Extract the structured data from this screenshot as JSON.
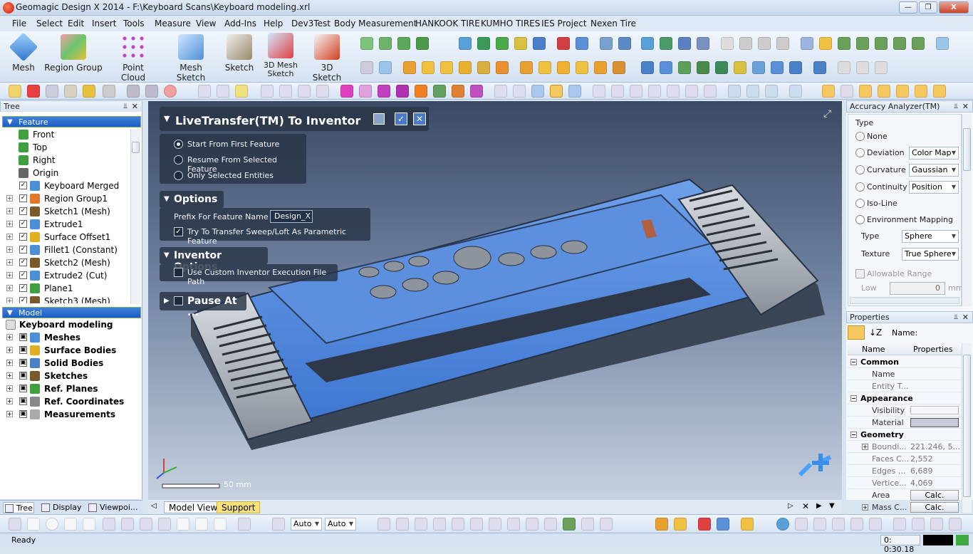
{
  "window": {
    "title": "Geomagic Design X 2014 - F:\\Keyboard Scans\\Keyboard modeling.xrl",
    "min": "—",
    "max": "❐",
    "close": "X"
  },
  "menu": [
    "File",
    "Select",
    "Edit",
    "Insert",
    "Tools",
    "Measure",
    "View",
    "Add-Ins",
    "Help",
    "Dev3Test",
    "Body Measurement",
    "HANKOOK TIRE",
    "KUMHO TIRES",
    "IES Project",
    "Nexen Tire"
  ],
  "ribbon": {
    "buttons": [
      "Mesh",
      "Region Group",
      "Point Cloud",
      "Mesh Sketch",
      "Sketch",
      "3D Mesh Sketch",
      "3D Sketch"
    ]
  },
  "tree": {
    "header": "Tree",
    "feature_section": "Feature",
    "features": [
      {
        "label": "Front",
        "color": "#3fa03f"
      },
      {
        "label": "Top",
        "color": "#3fa03f"
      },
      {
        "label": "Right",
        "color": "#3fa03f"
      },
      {
        "label": "Origin",
        "color": "#444444"
      },
      {
        "label": "Keyboard Merged",
        "color": "#4a90d9"
      },
      {
        "label": "Region Group1",
        "color": "#e07a2a"
      },
      {
        "label": "Sketch1 (Mesh)",
        "color": "#7a5a2a"
      },
      {
        "label": "Extrude1",
        "color": "#4a90d9"
      },
      {
        "label": "Surface Offset1",
        "color": "#e0b020"
      },
      {
        "label": "Fillet1 (Constant)",
        "color": "#4a90d9"
      },
      {
        "label": "Sketch2 (Mesh)",
        "color": "#7a5a2a"
      },
      {
        "label": "Extrude2 (Cut)",
        "color": "#4a90d9"
      },
      {
        "label": "Plane1",
        "color": "#3fa03f"
      },
      {
        "label": "Sketch3 (Mesh)",
        "color": "#7a5a2a"
      }
    ],
    "model_section": "Model",
    "model_root": "Keyboard modeling",
    "model_items": [
      "Meshes",
      "Surface Bodies",
      "Solid Bodies",
      "Sketches",
      "Ref. Planes",
      "Ref. Coordinates",
      "Measurements"
    ],
    "tabs": [
      "Tree",
      "Display",
      "Viewpoi..."
    ]
  },
  "dialog": {
    "title": "LiveTransfer(TM) To Inventor",
    "start_options": [
      "Start From First Feature",
      "Resume From Selected Feature",
      "Only Selected Entities"
    ],
    "selected_start": 0,
    "options_header": "Options",
    "prefix_label": "Prefix For Feature Name",
    "prefix_value": "Design_X",
    "sweep_label": "Try To Transfer Sweep/Loft As Parametric Feature",
    "sweep_checked": true,
    "inventor_header": "Inventor Options",
    "custom_path_label": "Use Custom Inventor Execution File Path",
    "custom_path_checked": false,
    "pause_label": "Pause At ...",
    "pause_checked": false
  },
  "viewport": {
    "scale_label": "50 mm",
    "tabs": [
      "Model View",
      "Support"
    ]
  },
  "accuracy": {
    "header": "Accuracy Analyzer(TM)",
    "type_label": "Type",
    "types": [
      {
        "label": "None",
        "selected": true,
        "select": ""
      },
      {
        "label": "Deviation",
        "selected": false,
        "select": "Color Map"
      },
      {
        "label": "Curvature",
        "selected": false,
        "select": "Gaussian"
      },
      {
        "label": "Continuity",
        "selected": false,
        "select": "Position"
      },
      {
        "label": "Iso-Line",
        "selected": false,
        "select": ""
      },
      {
        "label": "Environment Mapping",
        "selected": false,
        "select": ""
      }
    ],
    "env_type_label": "Type",
    "env_type_value": "Sphere",
    "texture_label": "Texture",
    "texture_value": "True Sphere",
    "allowable_range": "Allowable Range",
    "low_label": "Low",
    "low_value": "0",
    "unit": "mm"
  },
  "properties": {
    "header": "Properties",
    "name_label": "Name:",
    "col_name": "Name",
    "col_props": "Properties",
    "rows": [
      {
        "kind": "group",
        "name": "Common"
      },
      {
        "kind": "item",
        "name": "Name",
        "value": ""
      },
      {
        "kind": "item",
        "name": "Entity T...",
        "value": ""
      },
      {
        "kind": "group",
        "name": "Appearance"
      },
      {
        "kind": "item",
        "name": "Visibility",
        "value": ""
      },
      {
        "kind": "item",
        "name": "Material",
        "value": ""
      },
      {
        "kind": "group",
        "name": "Geometry"
      },
      {
        "kind": "item",
        "name": "Boundi...",
        "value": "221.246, 5..."
      },
      {
        "kind": "item",
        "name": "Faces C...",
        "value": "2,552"
      },
      {
        "kind": "item",
        "name": "Edges ...",
        "value": "6,689"
      },
      {
        "kind": "item",
        "name": "Vertice...",
        "value": "4,069"
      },
      {
        "kind": "item",
        "name": "Area",
        "value": "Calc."
      },
      {
        "kind": "item",
        "name": "Mass C...",
        "value": "Calc."
      }
    ]
  },
  "bottombar": {
    "auto1": "Auto",
    "auto2": "Auto"
  },
  "status": {
    "left": "Ready",
    "time": "0: 0:30.18"
  }
}
